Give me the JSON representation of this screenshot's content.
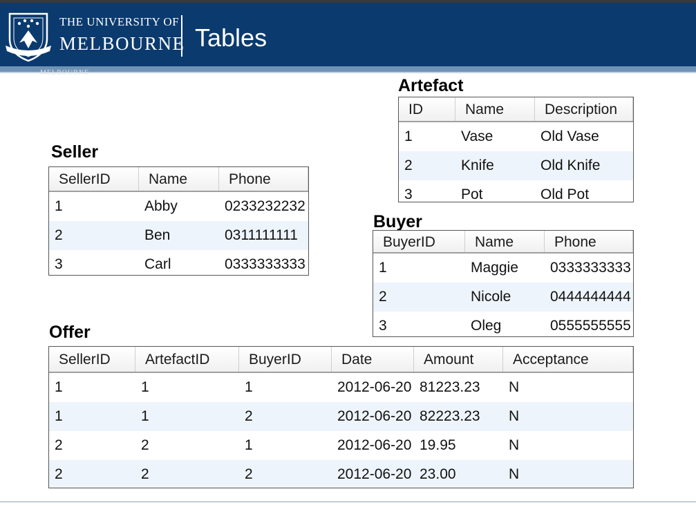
{
  "header": {
    "university_small": "THE UNIVERSITY OF",
    "university_big": "MELBOURNE",
    "slide_title": "Tables",
    "ghost_text": "MELBOURNE"
  },
  "tables": {
    "artefact": {
      "caption": "Artefact",
      "columns": [
        "ID",
        "Name",
        "Description"
      ],
      "rows": [
        [
          "1",
          "Vase",
          "Old Vase"
        ],
        [
          "2",
          "Knife",
          "Old Knife"
        ],
        [
          "3",
          "Pot",
          "Old Pot"
        ]
      ]
    },
    "seller": {
      "caption": "Seller",
      "columns": [
        "SellerID",
        "Name",
        "Phone"
      ],
      "rows": [
        [
          "1",
          "Abby",
          "0233232232"
        ],
        [
          "2",
          "Ben",
          "0311111111"
        ],
        [
          "3",
          "Carl",
          "0333333333"
        ]
      ]
    },
    "buyer": {
      "caption": "Buyer",
      "columns": [
        "BuyerID",
        "Name",
        "Phone"
      ],
      "rows": [
        [
          "1",
          "Maggie",
          "0333333333"
        ],
        [
          "2",
          "Nicole",
          "0444444444"
        ],
        [
          "3",
          "Oleg",
          "0555555555"
        ]
      ]
    },
    "offer": {
      "caption": "Offer",
      "columns": [
        "SellerID",
        "ArtefactID",
        "BuyerID",
        "Date",
        "Amount",
        "Acceptance"
      ],
      "rows": [
        [
          "1",
          "1",
          "1",
          "2012-06-20",
          "81223.23",
          "N"
        ],
        [
          "1",
          "1",
          "2",
          "2012-06-20",
          "82223.23",
          "N"
        ],
        [
          "2",
          "2",
          "1",
          "2012-06-20",
          "19.95",
          "N"
        ],
        [
          "2",
          "2",
          "2",
          "2012-06-20",
          "23.00",
          "N"
        ]
      ]
    }
  },
  "colors": {
    "header_bg": "#0b3a6e",
    "header_strip": "#6f93b4",
    "row_alt": "#eef4fb"
  }
}
